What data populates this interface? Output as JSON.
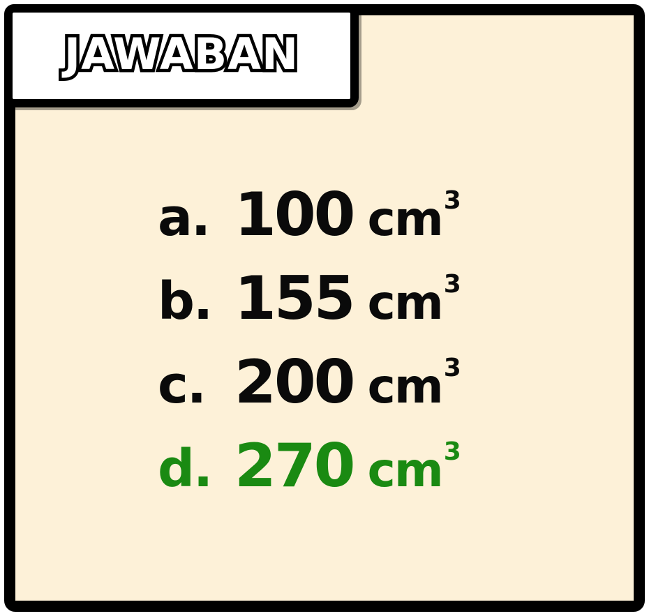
{
  "header": {
    "title": "JAWABAN"
  },
  "options": [
    {
      "letter": "a.",
      "value": "100",
      "unit": "cm",
      "exponent": "3",
      "correct": false
    },
    {
      "letter": "b.",
      "value": "155",
      "unit": "cm",
      "exponent": "3",
      "correct": false
    },
    {
      "letter": "c.",
      "value": "200",
      "unit": "cm",
      "exponent": "3",
      "correct": false
    },
    {
      "letter": "d.",
      "value": "270",
      "unit": "cm",
      "exponent": "3",
      "correct": true
    }
  ],
  "colors": {
    "background": "#fdf1d8",
    "border": "#000000",
    "text": "#0a0a0a",
    "correct": "#1a8a12",
    "header_bg": "#ffffff"
  }
}
